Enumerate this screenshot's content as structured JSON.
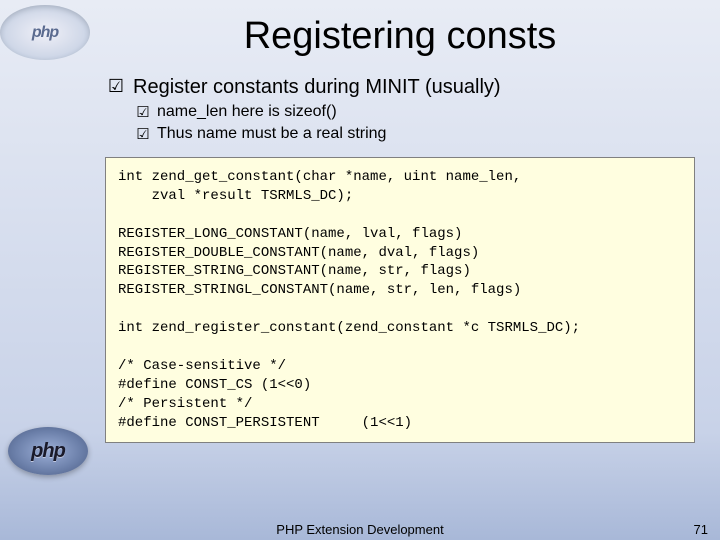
{
  "logo": {
    "top": "php",
    "bottom": "php"
  },
  "title": "Registering consts",
  "bullets": {
    "main": "Register constants during MINIT (usually)",
    "sub1": "name_len here is sizeof()",
    "sub2": "Thus name must be a real string"
  },
  "code": "int zend_get_constant(char *name, uint name_len, \n    zval *result TSRMLS_DC);\n\nREGISTER_LONG_CONSTANT(name, lval, flags)\nREGISTER_DOUBLE_CONSTANT(name, dval, flags)\nREGISTER_STRING_CONSTANT(name, str, flags)\nREGISTER_STRINGL_CONSTANT(name, str, len, flags)\n\nint zend_register_constant(zend_constant *c TSRMLS_DC);\n\n/* Case-sensitive */\n#define CONST_CS (1<<0)\n/* Persistent */\n#define CONST_PERSISTENT     (1<<1)",
  "footer": {
    "label": "PHP Extension Development",
    "page": "71"
  }
}
